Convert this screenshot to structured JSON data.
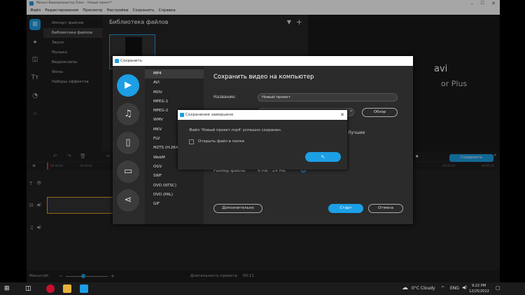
{
  "app": {
    "title": "Movavi Видеоредактор Плюс - Новый проект*",
    "menu": [
      "Файл",
      "Редактирование",
      "Просмотр",
      "Настройки",
      "Сохранить",
      "Справка"
    ],
    "categories": [
      "Импорт файлов",
      "Библиотека файлов",
      "Звуки",
      "Музыка",
      "Видеоклипы",
      "Фоны",
      "Наборы эффектов"
    ],
    "selected_category": 1,
    "library_title": "Библиотека файлов",
    "player_brand_1": "avi",
    "player_brand_2": "or Plus",
    "timeline_time": "00:00:00",
    "save_button": "Сохранить",
    "status_scale": "Масштаб:",
    "status_duration_label": "Длительность проекта:",
    "status_duration": "00:11",
    "timecodes": [
      "00:00:05",
      "00:00:10",
      "00:00:15"
    ]
  },
  "save_dialog": {
    "title": "Сохранить",
    "formats": [
      "MP4",
      "AVI",
      "MOV",
      "MPEG-1",
      "MPEG-2",
      "WMV",
      "MKV",
      "FLV",
      "M2TS (H.264)",
      "WebM",
      "OGV",
      "SWF",
      "DVD (NTSC)",
      "DVD (PAL)",
      "GIF"
    ],
    "selected_format": 0,
    "heading": "Сохранить видео на компьютер",
    "name_label": "Название:",
    "name_value": "Новый проект",
    "browse": "Обзор",
    "quality_value": "Лучшее",
    "file_size_label": "Размер файла:",
    "file_size_value": "6 МБ - 24 МБ",
    "advanced": "Дополнительно",
    "start": "Старт",
    "cancel": "Отмена"
  },
  "done_dialog": {
    "title": "Сохранение завершено",
    "message": "Файл 'Новый проект.mp4' успешно сохранен.",
    "checkbox_label": "Открыть файл в папке"
  },
  "taskbar": {
    "weather": "0°C  Cloudy",
    "lang": "ENG",
    "time": "9:22 PM",
    "date": "12/25/2022"
  },
  "colors": {
    "accent": "#1c9fe5",
    "bg": "#252525"
  }
}
